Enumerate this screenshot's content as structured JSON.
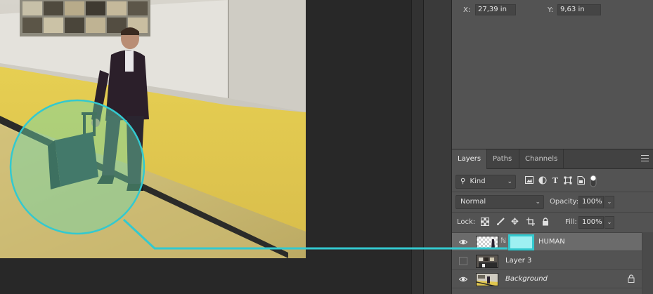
{
  "properties": {
    "x_label": "X:",
    "x_value": "27,39 in",
    "y_label": "Y:",
    "y_value": "9,63 in"
  },
  "layers_panel": {
    "tabs": [
      "Layers",
      "Paths",
      "Channels"
    ],
    "active_tab": "Layers",
    "filter_kind": "Kind",
    "blend_mode": "Normal",
    "opacity_label": "Opacity:",
    "opacity_value": "100%",
    "lock_label": "Lock:",
    "fill_label": "Fill:",
    "fill_value": "100%",
    "layers": [
      {
        "name": "HUMAN",
        "visible": true,
        "selected": true,
        "has_mask": true
      },
      {
        "name": "Layer 3",
        "visible": false,
        "selected": false
      },
      {
        "name": "Background",
        "visible": true,
        "selected": false,
        "locked": true
      }
    ]
  },
  "colors": {
    "highlight": "#33c9cf",
    "mask_fill": "#9ef0f2",
    "panel_bg": "#535353",
    "selected_row": "#6b6b6b"
  },
  "icons": {
    "visibility": "eye-icon",
    "filter_search": "search-icon",
    "lock": "lock-icon",
    "panel_menu": "hamburger-menu-icon"
  }
}
